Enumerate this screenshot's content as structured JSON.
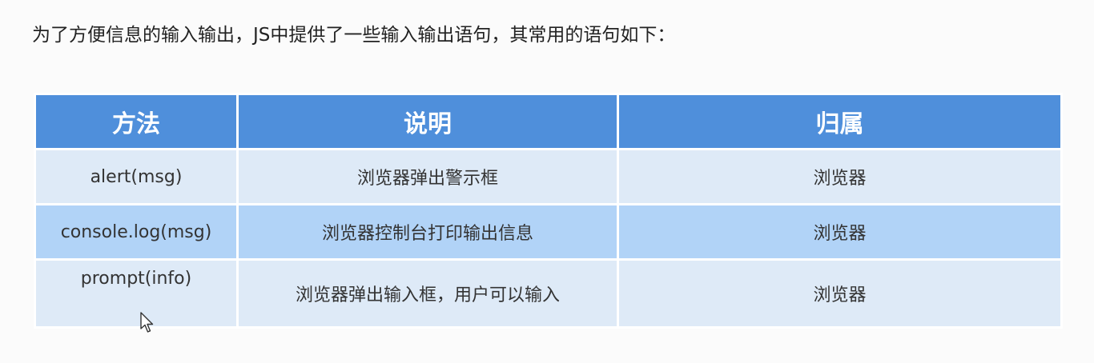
{
  "intro": "为了方便信息的输入输出，JS中提供了一些输入输出语句，其常用的语句如下：",
  "table": {
    "headers": [
      "方法",
      "说明",
      "归属"
    ],
    "rows": [
      [
        "alert(msg)",
        "浏览器弹出警示框",
        "浏览器"
      ],
      [
        "console.log(msg)",
        "浏览器控制台打印输出信息",
        "浏览器"
      ],
      [
        "prompt(info)",
        "浏览器弹出输入框，用户可以输入",
        "浏览器"
      ]
    ]
  },
  "colors": {
    "header_bg": "#4f8fdb",
    "row_light": "#deeaf7",
    "row_blue": "#b1d3f7"
  },
  "icons": {
    "cursor": "mouse-pointer-icon"
  }
}
